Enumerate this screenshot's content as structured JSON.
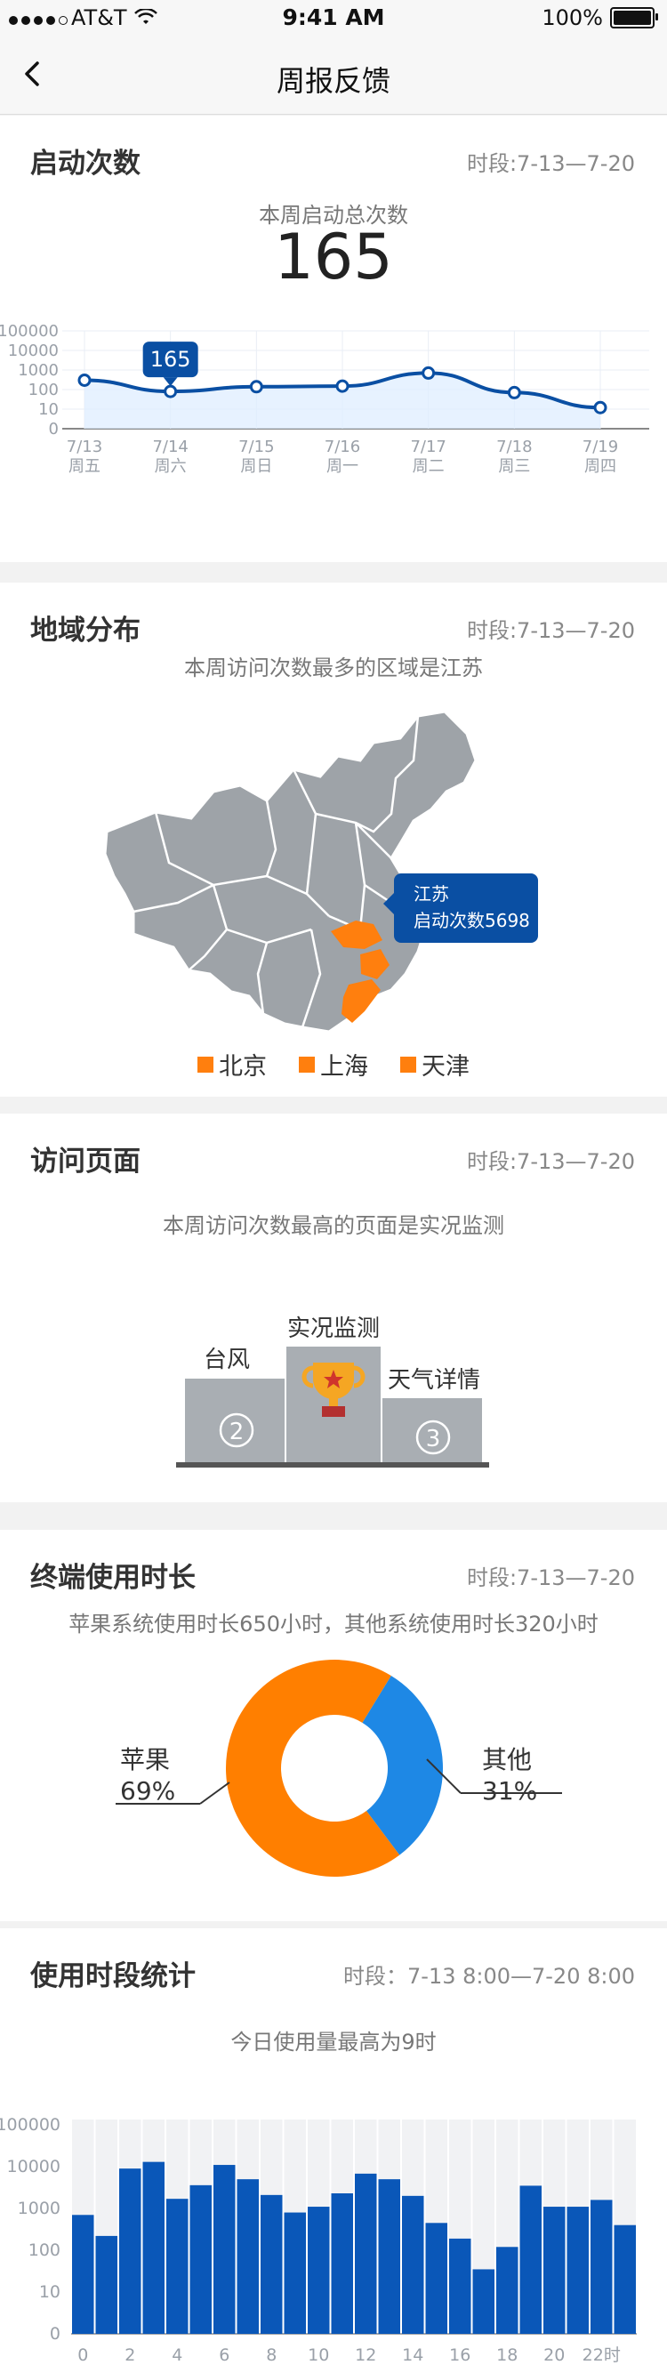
{
  "status": {
    "carrier": "AT&T",
    "time": "9:41 AM",
    "battery": "100%"
  },
  "nav": {
    "title": "周报反馈"
  },
  "launch": {
    "title": "启动次数",
    "period": "时段:7-13—7-20",
    "subtitle": "本周启动总次数",
    "total": "165",
    "tooltip": "165",
    "chart_data": {
      "type": "line",
      "scale": "log",
      "y_ticks": [
        "0",
        "10",
        "100",
        "1000",
        "10000",
        "100000"
      ],
      "x_dates": [
        "7/13",
        "7/14",
        "7/15",
        "7/16",
        "7/17",
        "7/18",
        "7/19"
      ],
      "x_days": [
        "周五",
        "周六",
        "周日",
        "周一",
        "周二",
        "周三",
        "周四"
      ],
      "values": [
        300,
        80,
        140,
        150,
        700,
        70,
        12
      ]
    }
  },
  "region": {
    "title": "地域分布",
    "period": "时段:7-13—7-20",
    "subtitle": "本周访问次数最多的区域是江苏",
    "tooltip_line1": "江苏",
    "tooltip_line2": "启动次数5698",
    "legend": [
      "北京",
      "上海",
      "天津"
    ],
    "highlight_color": "#ff7f0e",
    "map_color": "#9ea3a8"
  },
  "pages": {
    "title": "访问页面",
    "period": "时段:7-13—7-20",
    "subtitle": "本周访问次数最高的页面是实况监测",
    "first": "实况监测",
    "second": "台风",
    "third": "天气详情",
    "second_rank": "2",
    "third_rank": "3"
  },
  "device": {
    "title": "终端使用时长",
    "period": "时段:7-13—7-20",
    "subtitle": "苹果系统使用时长650小时，其他系统使用时长320小时",
    "chart_data": {
      "type": "pie",
      "slices": [
        {
          "name": "苹果",
          "label": "69%",
          "value": 69,
          "color": "#ff7f00"
        },
        {
          "name": "其他",
          "label": "31%",
          "value": 31,
          "color": "#1e88e5"
        }
      ]
    }
  },
  "usage": {
    "title": "使用时段统计",
    "period": "时段：7-13 8:00—7-20 8:00",
    "subtitle": "今日使用量最高为9时",
    "chart_data": {
      "type": "bar",
      "scale": "log",
      "y_ticks": [
        "0",
        "10",
        "100",
        "1000",
        "10000",
        "100000"
      ],
      "x_ticks": [
        "0",
        "2",
        "4",
        "6",
        "8",
        "10",
        "12",
        "14",
        "16",
        "18",
        "20",
        "22时"
      ],
      "values": [
        700,
        220,
        9000,
        13000,
        1700,
        3600,
        11000,
        5000,
        2100,
        800,
        1100,
        2300,
        6800,
        5000,
        2000,
        450,
        190,
        35,
        120,
        3500,
        1100,
        1100,
        1600,
        400
      ]
    }
  }
}
